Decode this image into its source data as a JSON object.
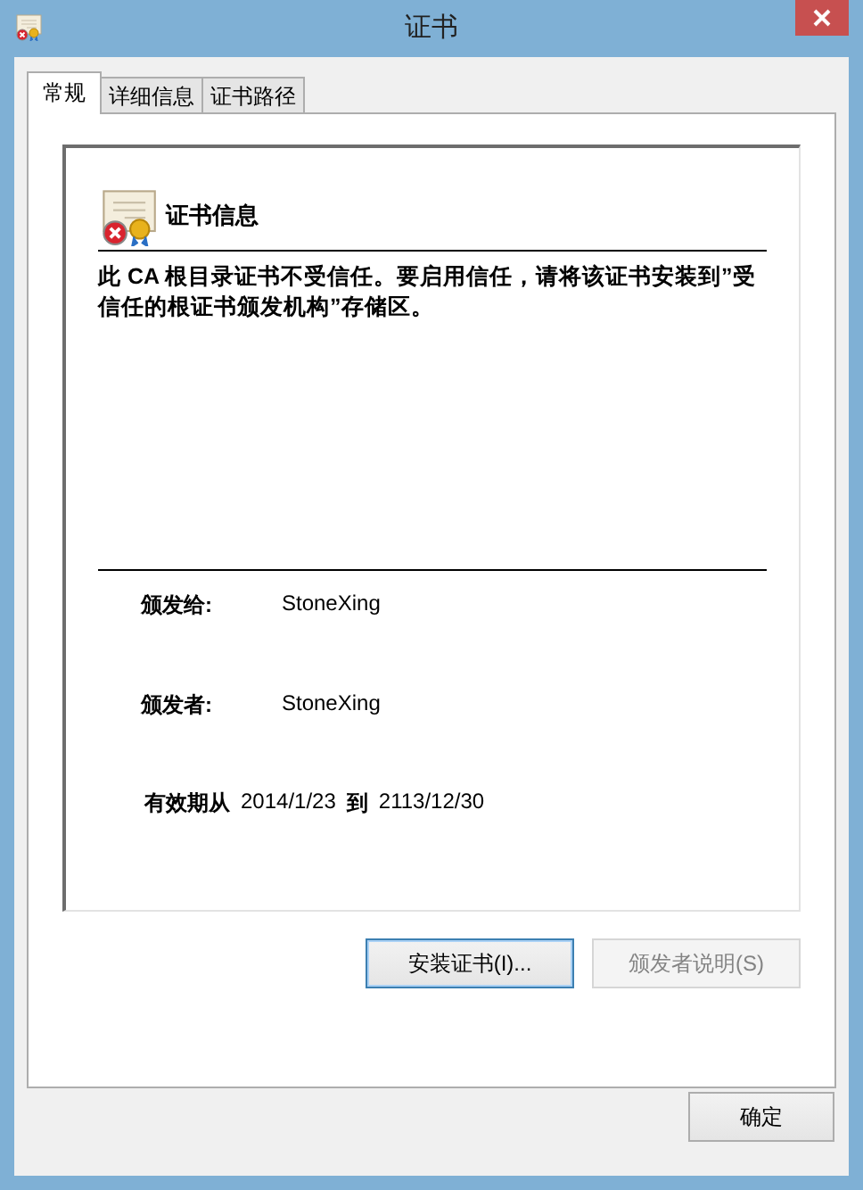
{
  "window": {
    "title": "证书"
  },
  "tabs": [
    {
      "label": "常规",
      "selected": true
    },
    {
      "label": "详细信息",
      "selected": false
    },
    {
      "label": "证书路径",
      "selected": false
    }
  ],
  "info": {
    "heading": "证书信息",
    "message": "此 CA 根目录证书不受信任。要启用信任，请将该证书安装到”受信任的根证书颁发机构”存储区。",
    "fields": [
      {
        "label": "颁发给:",
        "value": "StoneXing"
      },
      {
        "label": "颁发者:",
        "value": "StoneXing"
      }
    ],
    "validity": {
      "label": "有效期从",
      "from": "2014/1/23",
      "to_label": "到",
      "to": "2113/12/30"
    }
  },
  "buttons": [
    {
      "label": "安装证书(I)...",
      "disabled": false
    },
    {
      "label": "颁发者说明(S)",
      "disabled": true
    }
  ],
  "ok_button": {
    "label": "确定"
  }
}
